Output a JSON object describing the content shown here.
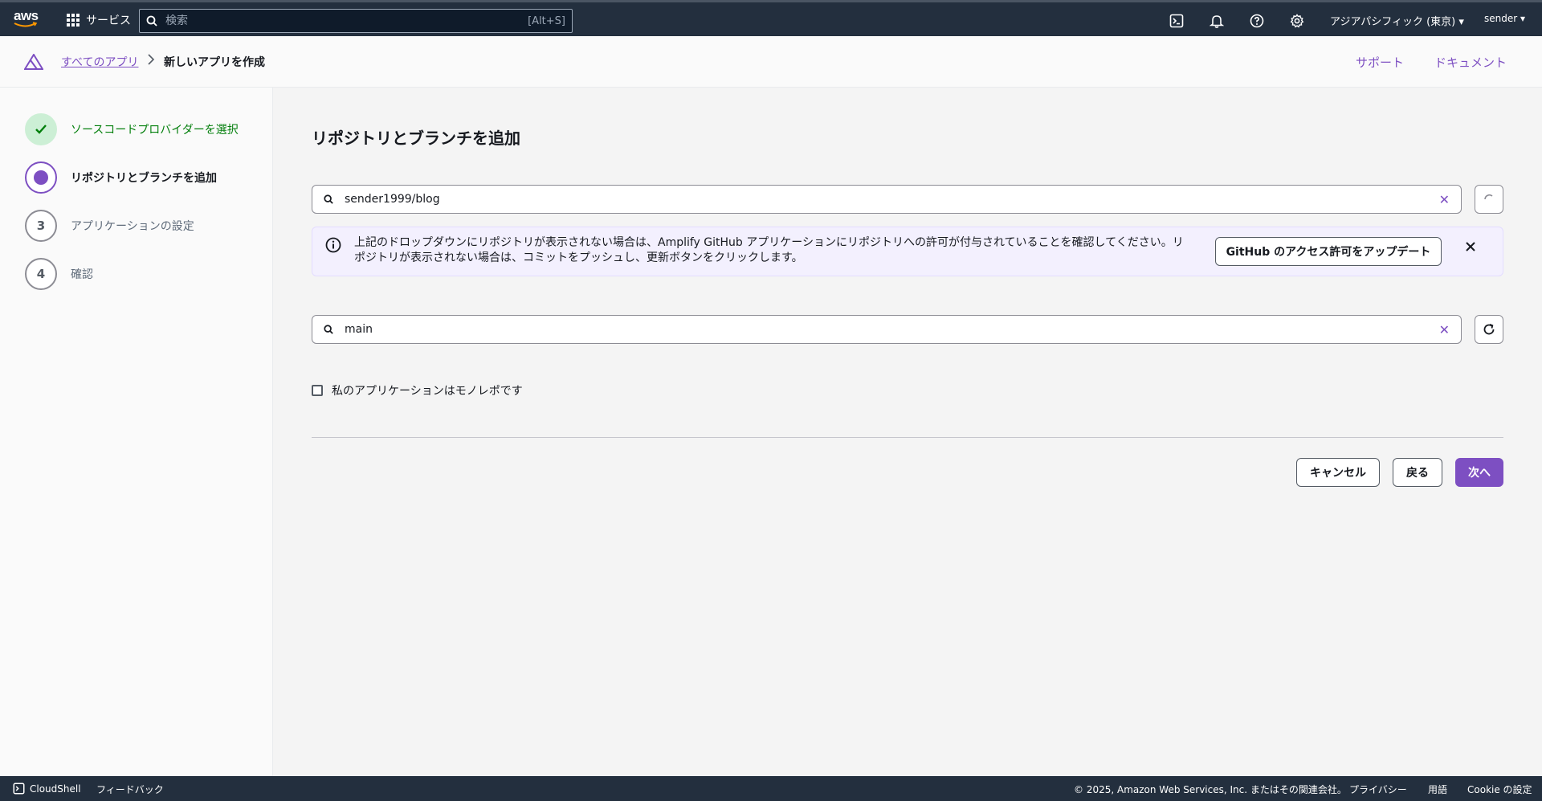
{
  "topnav": {
    "logo_text": "aws",
    "services_label": "サービス",
    "search_placeholder": "検索",
    "search_shortcut": "[Alt+S]",
    "region_label": "アジアパシフィック (東京) ▾",
    "user_label": "sender ▾",
    "icons": [
      "cloudshell-icon",
      "bell-icon",
      "help-icon",
      "settings-icon"
    ]
  },
  "header": {
    "breadcrumb_link": "すべてのアプリ",
    "breadcrumb_current": "新しいアプリを作成",
    "support_link": "サポート",
    "docs_link": "ドキュメント"
  },
  "sidebar": {
    "steps": [
      {
        "number": "",
        "label": "ソースコードプロバイダーを選択",
        "state": "done"
      },
      {
        "number": "",
        "label": "リポジトリとブランチを追加",
        "state": "active"
      },
      {
        "number": "3",
        "label": "アプリケーションの設定",
        "state": "todo"
      },
      {
        "number": "4",
        "label": "確認",
        "state": "todo"
      }
    ]
  },
  "main": {
    "title": "リポジトリとブランチを追加",
    "repo_value": "sender1999/blog",
    "branch_value": "main",
    "info_text": "上記のドロップダウンにリポジトリが表示されない場合は、Amplify GitHub アプリケーションにリポジトリへの許可が付与されていることを確認してください。リポジトリが表示されない場合は、コミットをプッシュし、更新ボタンをクリックします。",
    "github_button": "GitHub のアクセス許可をアップデート",
    "monorepo_label": "私のアプリケーションはモノレポです",
    "cancel_button": "キャンセル",
    "back_button": "戻る",
    "next_button": "次へ"
  },
  "footer": {
    "cloudshell": "CloudShell",
    "feedback": "フィードバック",
    "copyright": "© 2025, Amazon Web Services, Inc. またはその関連会社。",
    "privacy": "プライバシー",
    "terms": "用語",
    "cookie": "Cookie の設定"
  },
  "colors": {
    "accent": "#7d4fc2",
    "nav_bg": "#232f3e",
    "success": "#037f0c",
    "info_bg": "#f3f0fe"
  }
}
